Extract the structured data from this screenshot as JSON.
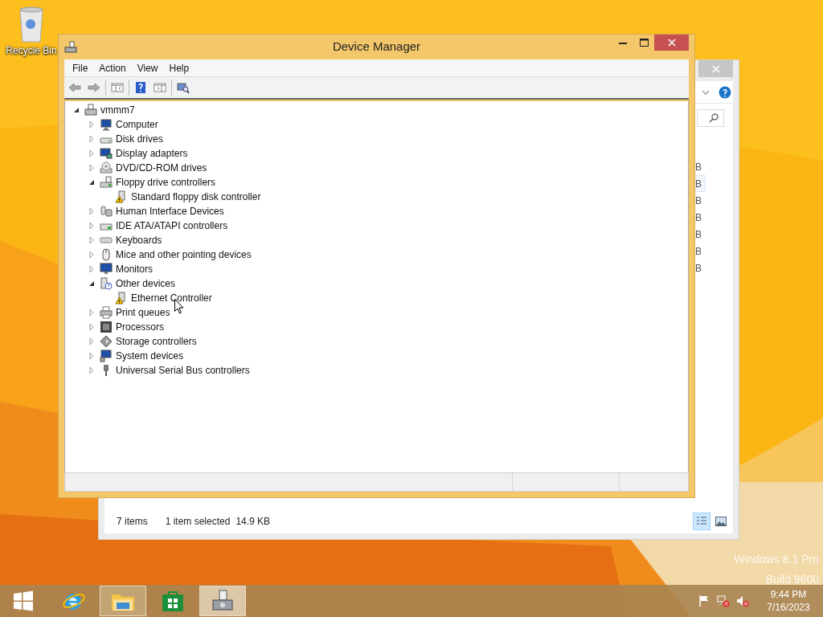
{
  "desktop": {
    "icons": [
      {
        "label": "Recycle Bin"
      }
    ],
    "os_watermark": [
      "Windows 8.1 Pro",
      "Build 9600"
    ]
  },
  "explorer_window": {
    "size_column": [
      {
        "text": "B",
        "selected": false
      },
      {
        "text": "B",
        "selected": true
      },
      {
        "text": "B",
        "selected": false
      },
      {
        "text": "B",
        "selected": false
      },
      {
        "text": "B",
        "selected": false
      },
      {
        "text": "B",
        "selected": false
      },
      {
        "text": "B",
        "selected": false
      }
    ],
    "status_bar": {
      "item_count": "7 items",
      "selection": "1 item selected",
      "size": "14.9 KB"
    },
    "view_buttons": [
      {
        "selected": true
      },
      {
        "selected": false
      }
    ]
  },
  "device_manager": {
    "title": "Device Manager",
    "menu": [
      "File",
      "Action",
      "View",
      "Help"
    ],
    "tree": {
      "label": "vmmm7",
      "expanded": true,
      "children": [
        {
          "label": "Computer",
          "expanded": false
        },
        {
          "label": "Disk drives",
          "expanded": false
        },
        {
          "label": "Display adapters",
          "expanded": false
        },
        {
          "label": "DVD/CD-ROM drives",
          "expanded": false
        },
        {
          "label": "Floppy drive controllers",
          "expanded": true,
          "children": [
            {
              "label": "Standard floppy disk controller",
              "warning": true
            }
          ]
        },
        {
          "label": "Human Interface Devices",
          "expanded": false
        },
        {
          "label": "IDE ATA/ATAPI controllers",
          "expanded": false
        },
        {
          "label": "Keyboards",
          "expanded": false
        },
        {
          "label": "Mice and other pointing devices",
          "expanded": false
        },
        {
          "label": "Monitors",
          "expanded": false
        },
        {
          "label": "Other devices",
          "expanded": true,
          "children": [
            {
              "label": "Ethernet Controller",
              "warning": true
            }
          ]
        },
        {
          "label": "Print queues",
          "expanded": false
        },
        {
          "label": "Processors",
          "expanded": false
        },
        {
          "label": "Storage controllers",
          "expanded": false
        },
        {
          "label": "System devices",
          "expanded": false
        },
        {
          "label": "Universal Serial Bus controllers",
          "expanded": false
        }
      ]
    }
  },
  "taskbar": {
    "apps": [
      {
        "running": false,
        "selected": false
      },
      {
        "running": false,
        "selected": false
      },
      {
        "running": true,
        "selected": false
      },
      {
        "running": false,
        "selected": false
      },
      {
        "running": true,
        "selected": true
      }
    ],
    "clock": {
      "time": "9:44 PM",
      "date": "7/16/2023"
    }
  }
}
